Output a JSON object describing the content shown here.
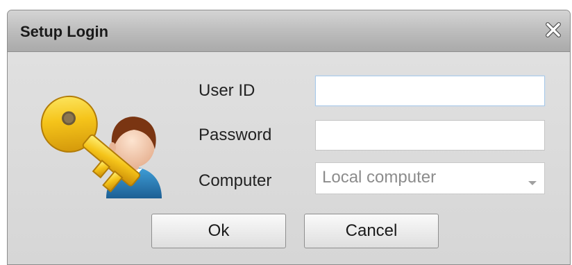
{
  "dialog": {
    "title": "Setup Login",
    "close_icon": "close-icon",
    "login_icon": "key-user-icon"
  },
  "form": {
    "user_id_label": "User ID",
    "user_id_value": "",
    "password_label": "Password",
    "password_value": "",
    "computer_label": "Computer",
    "computer_selected": "Local computer",
    "computer_dropdown_icon": "dropdown-arrow-icon"
  },
  "buttons": {
    "ok_label": "Ok",
    "cancel_label": "Cancel"
  },
  "colors": {
    "titlebar": "#b8b8b8",
    "dialog_body": "#dcdcdc",
    "focus_border": "#a8c8e8",
    "placeholder_text": "#8c8c8c"
  }
}
